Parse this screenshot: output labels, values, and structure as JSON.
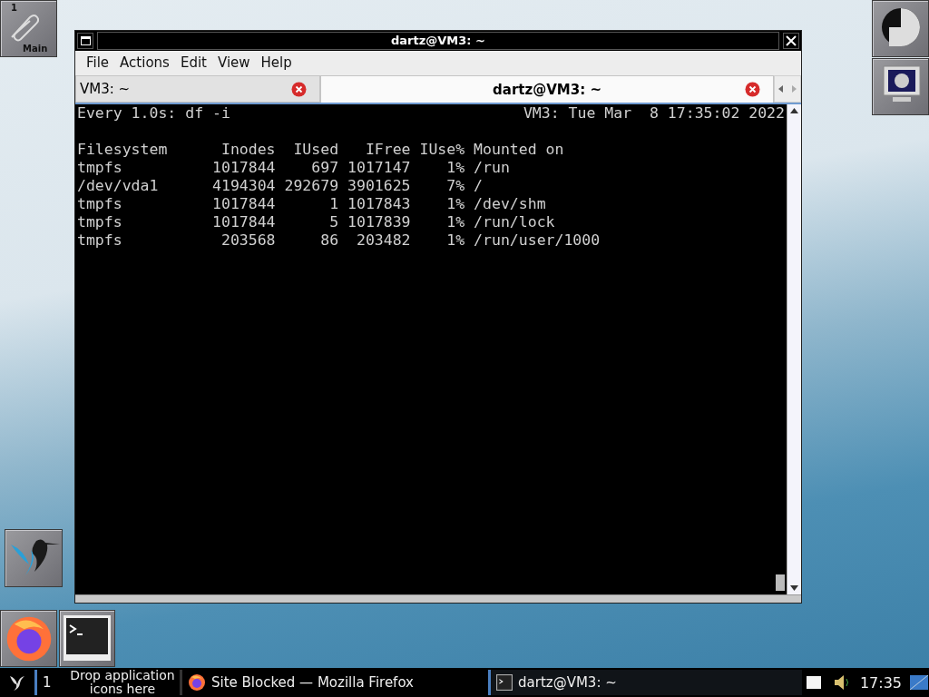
{
  "workspace_tile": {
    "number": "1",
    "label": "Main"
  },
  "window": {
    "title": "dartz@VM3: ~",
    "menu": [
      "File",
      "Actions",
      "Edit",
      "View",
      "Help"
    ],
    "tabs": [
      {
        "label": "VM3: ~",
        "selected": false
      },
      {
        "label": "dartz@VM3: ~",
        "selected": true
      }
    ],
    "terminal": {
      "header_left": "Every 1.0s: df -i",
      "header_right": "VM3: Tue Mar  8 17:35:02 2022",
      "lines": [
        "Filesystem      Inodes  IUsed   IFree IUse% Mounted on",
        "tmpfs          1017844    697 1017147    1% /run",
        "/dev/vda1      4194304 292679 3901625    7% /",
        "tmpfs          1017844      1 1017843    1% /dev/shm",
        "tmpfs          1017844      5 1017839    1% /run/lock",
        "tmpfs           203568     86  203482    1% /run/user/1000"
      ]
    }
  },
  "taskbar": {
    "workspace": "1",
    "drop_hint": "Drop application icons here",
    "tasks": [
      {
        "kind": "browser",
        "label": "Site Blocked — Mozilla Firefox",
        "selected": false
      },
      {
        "kind": "terminal",
        "label": "dartz@VM3: ~",
        "selected": true
      }
    ],
    "clock": "17:35"
  }
}
